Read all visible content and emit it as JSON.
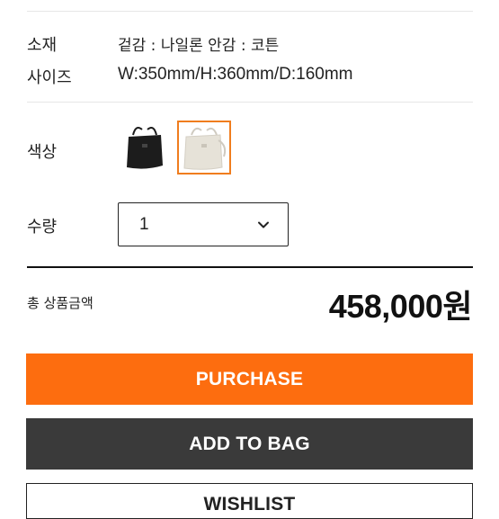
{
  "specs": {
    "material_label": "소재",
    "material_value": "겉감 : 나일론 안감 : 코튼",
    "size_label": "사이즈",
    "size_value": "W:350mm/H:360mm/D:160mm"
  },
  "color": {
    "label": "색상",
    "options": [
      {
        "name": "black",
        "color": "#1c1c1c",
        "selected": false
      },
      {
        "name": "ivory",
        "color": "#e6e2d8",
        "selected": true
      }
    ]
  },
  "quantity": {
    "label": "수량",
    "value": "1"
  },
  "total": {
    "label": "총 상품금액",
    "price": "458,000원"
  },
  "buttons": {
    "purchase": "PURCHASE",
    "add_to_bag": "ADD TO BAG",
    "wishlist": "WISHLIST"
  },
  "colors": {
    "accent": "#fd6d0f",
    "dark": "#3a3a3a"
  }
}
